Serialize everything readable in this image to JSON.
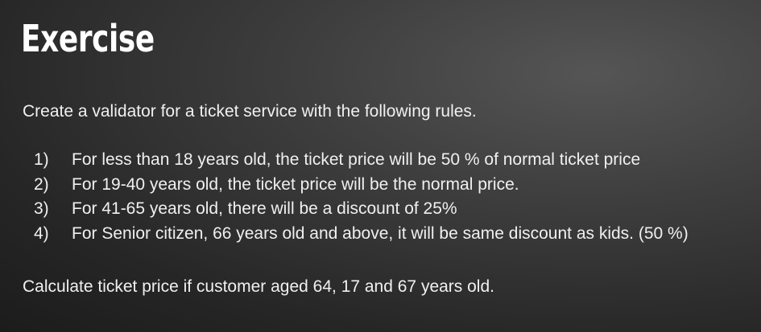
{
  "slide": {
    "title": "Exercise",
    "intro": "Create a validator for a ticket service with the following rules.",
    "rules": [
      {
        "number": "1)",
        "text": "For less than 18 years old, the ticket price will be 50 % of normal ticket price"
      },
      {
        "number": "2)",
        "text": "For 19-40 years old, the ticket price will be the normal price."
      },
      {
        "number": "3)",
        "text": "For 41-65 years old, there will be a discount of 25%"
      },
      {
        "number": "4)",
        "text": "For Senior citizen, 66 years old and above, it will be same discount as kids. (50 %)"
      }
    ],
    "closing": "Calculate ticket price if customer aged 64, 17 and 67 years old."
  }
}
